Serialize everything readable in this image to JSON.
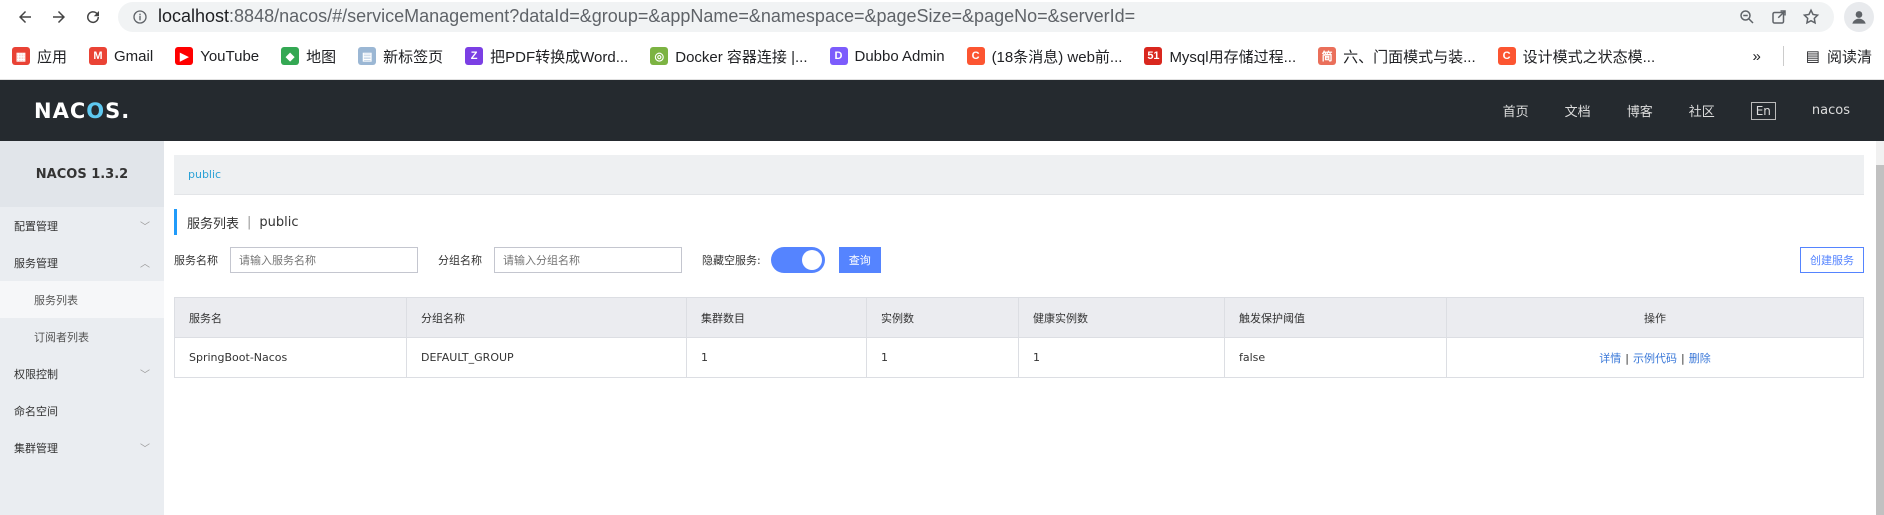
{
  "browser": {
    "url_host": "localhost",
    "url_rest": ":8848/nacos/#/serviceManagement?dataId=&group=&appName=&namespace=&pageSize=&pageNo=&serverId="
  },
  "bookmarks": [
    {
      "label": "应用",
      "icon": "apps-grid-icon",
      "color": "#e94235"
    },
    {
      "label": "Gmail",
      "icon": "gmail-icon",
      "color": "#ea4335"
    },
    {
      "label": "YouTube",
      "icon": "youtube-icon",
      "color": "#ff0000"
    },
    {
      "label": "地图",
      "icon": "maps-icon",
      "color": "#34a853"
    },
    {
      "label": "新标签页",
      "icon": "new-tab-icon",
      "color": "#9bb7d4"
    },
    {
      "label": "把PDF转换成Word...",
      "icon": "pdf-icon",
      "color": "#7b3fe4"
    },
    {
      "label": "Docker 容器连接 |...",
      "icon": "docker-icon",
      "color": "#7cb342"
    },
    {
      "label": "Dubbo Admin",
      "icon": "dubbo-icon",
      "color": "#7c5cfc"
    },
    {
      "label": "(18条消息) web前...",
      "icon": "csdn-icon",
      "color": "#fc5531"
    },
    {
      "label": "Mysql用存储过程...",
      "icon": "51cto-icon",
      "color": "#d9271e"
    },
    {
      "label": "六、门面模式与装...",
      "icon": "jianshu-icon",
      "color": "#ea6f5a"
    },
    {
      "label": "设计模式之状态模...",
      "icon": "csdn-icon",
      "color": "#fc5531"
    }
  ],
  "bookmarks_more": "»",
  "reading_list": "阅读清",
  "header": {
    "logo": "NACOS.",
    "nav": [
      "首页",
      "文档",
      "博客",
      "社区"
    ],
    "lang": "En",
    "user": "nacos"
  },
  "sidebar": {
    "title": "NACOS 1.3.2",
    "items": [
      {
        "label": "配置管理",
        "caret": "﹀"
      },
      {
        "label": "服务管理",
        "caret": "︿"
      },
      {
        "label": "服务列表",
        "sub": true,
        "active": true
      },
      {
        "label": "订阅者列表",
        "sub": true
      },
      {
        "label": "权限控制",
        "caret": "﹀"
      },
      {
        "label": "命名空间",
        "caret": ""
      },
      {
        "label": "集群管理",
        "caret": "﹀"
      }
    ]
  },
  "namespace_tab": "public",
  "page_title": {
    "main": "服务列表",
    "sep": "|",
    "ns": "public"
  },
  "filters": {
    "service_label": "服务名称",
    "service_placeholder": "请输入服务名称",
    "group_label": "分组名称",
    "group_placeholder": "请输入分组名称",
    "hide_empty_label": "隐藏空服务:",
    "hide_empty_on": true,
    "query_button": "查询",
    "create_button": "创建服务"
  },
  "table": {
    "columns": [
      "服务名",
      "分组名称",
      "集群数目",
      "实例数",
      "健康实例数",
      "触发保护阈值",
      "操作"
    ],
    "rows": [
      {
        "service": "SpringBoot-Nacos",
        "group": "DEFAULT_GROUP",
        "clusters": "1",
        "instances": "1",
        "healthy": "1",
        "threshold": "false",
        "actions": [
          "详情",
          "示例代码",
          "删除"
        ]
      }
    ]
  }
}
